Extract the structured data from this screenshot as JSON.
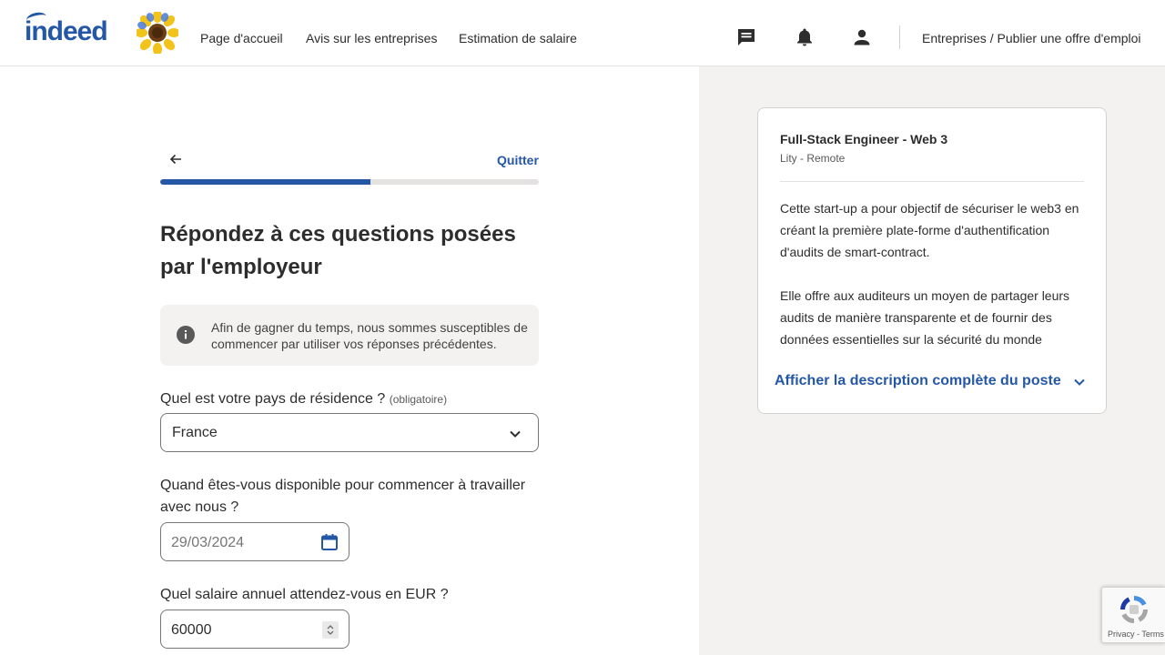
{
  "header": {
    "logo_text": "indeed",
    "nav": [
      "Page d'accueil",
      "Avis sur les entreprises",
      "Estimation de salaire"
    ],
    "icons": [
      "messages-icon",
      "notifications-bell-icon",
      "profile-icon"
    ],
    "employers_link": "Entreprises / Publier une offre d'emploi"
  },
  "form": {
    "quit_label": "Quitter",
    "progress_fraction": 0.555,
    "title": "Répondez à ces questions posées par l'employeur",
    "info_text": "Afin de gagner du temps, nous sommes susceptibles de commencer par utiliser vos réponses précédentes.",
    "q1": {
      "label": "Quel est votre pays de résidence ?",
      "required": "(obligatoire)",
      "value": "France"
    },
    "q2": {
      "label": "Quand êtes-vous disponible pour commencer à travailler avec nous ?",
      "value": "29/03/2024"
    },
    "q3": {
      "label": "Quel salaire annuel attendez-vous en EUR ?",
      "value": "60000"
    }
  },
  "job": {
    "title": "Full-Stack Engineer - Web 3",
    "company_location": "Lity - Remote",
    "description": [
      "Cette start-up a pour objectif de sécuriser le web3 en créant la première plate-forme d'authentification d'audits de smart-contract.",
      "Elle offre aux auditeurs un moyen de partager leurs audits de manière transparente et de fournir des données essentielles sur la sécurité du monde"
    ],
    "show_full_label": "Afficher la description complète du poste"
  },
  "recaptcha": {
    "links": "Privacy - Terms"
  },
  "colors": {
    "brand": "#2557a7",
    "text": "#2d2d2d",
    "panel_bg": "#f3f2f1"
  }
}
